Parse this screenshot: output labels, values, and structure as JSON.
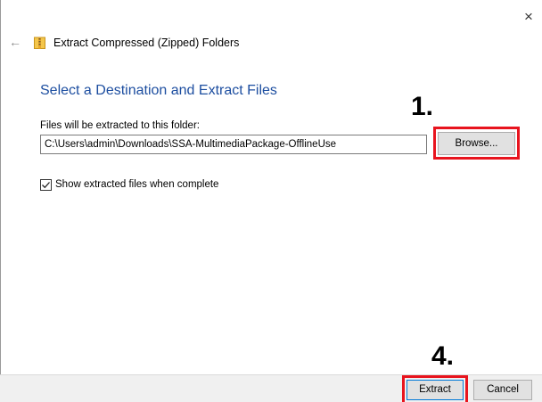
{
  "window": {
    "title": "Extract Compressed (Zipped) Folders",
    "close_glyph": "×",
    "back_glyph": "←",
    "title_icon": "zip-folder-icon"
  },
  "main": {
    "heading": "Select a Destination and Extract Files",
    "destination_label": "Files will be extracted to this folder:",
    "destination_value": "C:\\Users\\admin\\Downloads\\SSA-MultimediaPackage-OfflineUse",
    "browse_label": "Browse...",
    "show_files_label": "Show extracted files when complete",
    "show_files_checked": true
  },
  "annotations": {
    "step_browse": "1.",
    "step_extract": "4.",
    "highlight_color": "#e8141e"
  },
  "footer": {
    "extract_label": "Extract",
    "cancel_label": "Cancel"
  },
  "colors": {
    "heading": "#1d4ea0",
    "accent_border": "#0078d7",
    "footer_bg": "#f0f0f0"
  }
}
